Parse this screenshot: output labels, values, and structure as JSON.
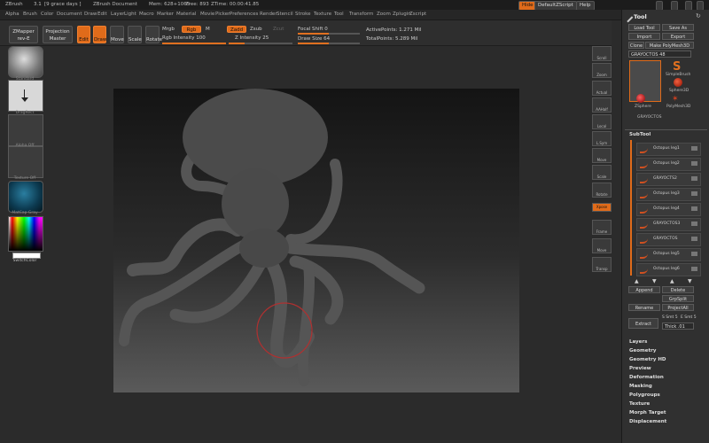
{
  "title_bar": {
    "app": "ZBrush",
    "version": "3.1",
    "grace": "[9 grace days ]",
    "document": "ZBrush Document",
    "mem": "Mem: 628+1065",
    "free": "Free: 893",
    "ztime": "ZTime: 00:00:41.85",
    "hide_label": "Hide",
    "script_label": "DefaultZScript",
    "help_label": "Help"
  },
  "menu": [
    "Alpha",
    "Brush",
    "Color",
    "Document",
    "Draw",
    "Edit",
    "Layer",
    "Light",
    "Macro",
    "Marker",
    "Material",
    "Movie",
    "Picker",
    "Preferences",
    "Render",
    "Stencil",
    "Stroke",
    "Texture",
    "Tool",
    "Transform",
    "Zoom",
    "Zplugin",
    "Zscript"
  ],
  "toolbar": {
    "zmapper": "ZMapper",
    "zmapper_sub": "rev-E",
    "projection": "Projection",
    "projection_sub": "Master",
    "edit": "Edit",
    "draw": "Draw",
    "move": "Move",
    "scale": "Scale",
    "rotate": "Rotate",
    "mrgb": "Mrgb",
    "rgb": "Rgb",
    "m": "M",
    "zadd": "Zadd",
    "zsub": "Zsub",
    "zcut": "Zcut",
    "rgb_intensity": "Rgb Intensity 100",
    "z_intensity": "Z Intensity 25",
    "focal_shift": "Focal Shift 0",
    "draw_size": "Draw Size 64",
    "active_points": "ActivePoints: 1.271 Mil",
    "total_points": "TotalPoints: 5.289 Mil",
    "rgb_intensity_value": 100,
    "z_intensity_value": 25,
    "focal_shift_value": 0,
    "draw_size_value": 64
  },
  "left_shelf": {
    "items": [
      "Standard",
      "DragRect",
      "Alpha Off",
      "Texture Off",
      "MatCap Gray",
      "SwitchColor"
    ]
  },
  "right_shelf": [
    "Scroll",
    "Zoom",
    "Actual",
    "AAHalf",
    "Local",
    "L.Sym",
    "Move",
    "Scale",
    "Rotate",
    "Xpose",
    "Frame",
    "Move",
    "Transp"
  ],
  "tool": {
    "title": "Tool",
    "load": "Load Tool",
    "save": "Save As",
    "import": "Import",
    "export": "Export",
    "clone": "Clone",
    "make": "Make PolyMesh3D",
    "current": "GRAYOCTOS 48",
    "tools": [
      "SimpleBrush",
      "Sphere3D",
      "ZSphere",
      "PolyMesh3D",
      "GRAYOCTOS"
    ],
    "subtool_label": "SubTool",
    "subtools": [
      "Octopus leg1",
      "Octopus leg2",
      "GRAYOCTS2",
      "Octopus leg3",
      "Octopus leg4",
      "GRAYOCTOS3",
      "GRAYOCTOS",
      "Octopus leg5",
      "Octopus leg6"
    ],
    "append": "Append",
    "delete": "Delete",
    "grpsplit": "GrpSplit",
    "rename": "Rename",
    "projectall": "ProjectAll",
    "extract": "Extract",
    "s_smt": "S Smt 5",
    "e_smt": "E Smt 5",
    "thick": "Thick .01",
    "sections": [
      "Layers",
      "Geometry",
      "Geometry HD",
      "Preview",
      "Deformation",
      "Masking",
      "Polygroups",
      "Texture",
      "Morph Target",
      "Displacement"
    ]
  },
  "colors": {
    "accent": "#e06b1a"
  }
}
